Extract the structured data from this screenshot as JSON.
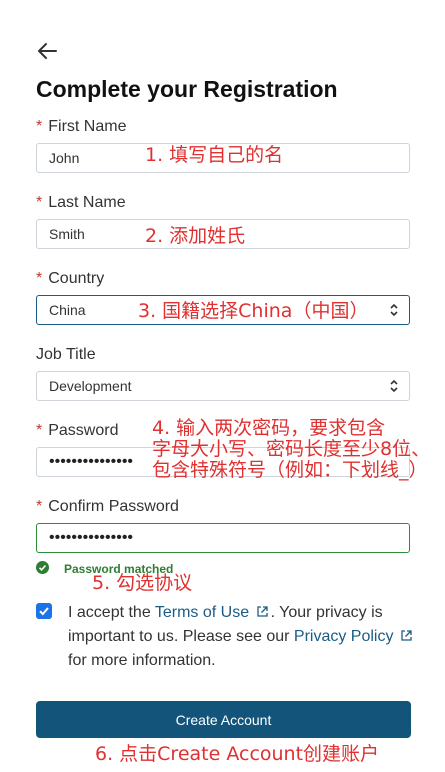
{
  "header": {
    "title": "Complete your Registration",
    "back_icon": "arrow-left-icon"
  },
  "form": {
    "required_mark": "*",
    "first_name": {
      "label": "First Name",
      "value": "John"
    },
    "last_name": {
      "label": "Last Name",
      "value": "Smith"
    },
    "country": {
      "label": "Country",
      "value": "China"
    },
    "job_title": {
      "label": "Job Title",
      "value": "Development"
    },
    "password": {
      "label": "Password",
      "value": "•••••••••••••••"
    },
    "confirm_password": {
      "label": "Confirm Password",
      "value": "•••••••••••••••"
    },
    "password_status": "Password matched",
    "consent": {
      "checked": true,
      "text_1": "I accept the ",
      "terms_link": "Terms of Use",
      "text_2": ". Your privacy is important to us. Please see our ",
      "privacy_link": "Privacy Policy",
      "text_3": " for more information."
    },
    "submit_label": "Create Account"
  },
  "annotations": {
    "a1": "1. 填写自己的名",
    "a2": "2. 添加姓氏",
    "a3": "3. 国籍选择China（中国）",
    "a4_line1": "4. 输入两次密码，要求包含",
    "a4_line2": "字母大小写、密码长度至少8位、",
    "a4_line3": "包含特殊符号（例如：下划线_）",
    "a5": "5. 勾选协议",
    "a6": "6. 点击Create Account创建账户"
  },
  "colors": {
    "primary": "#13547a",
    "required": "#c0392b",
    "annotation": "#e03030",
    "success": "#2e7d32",
    "checkbox": "#1a73e8"
  }
}
